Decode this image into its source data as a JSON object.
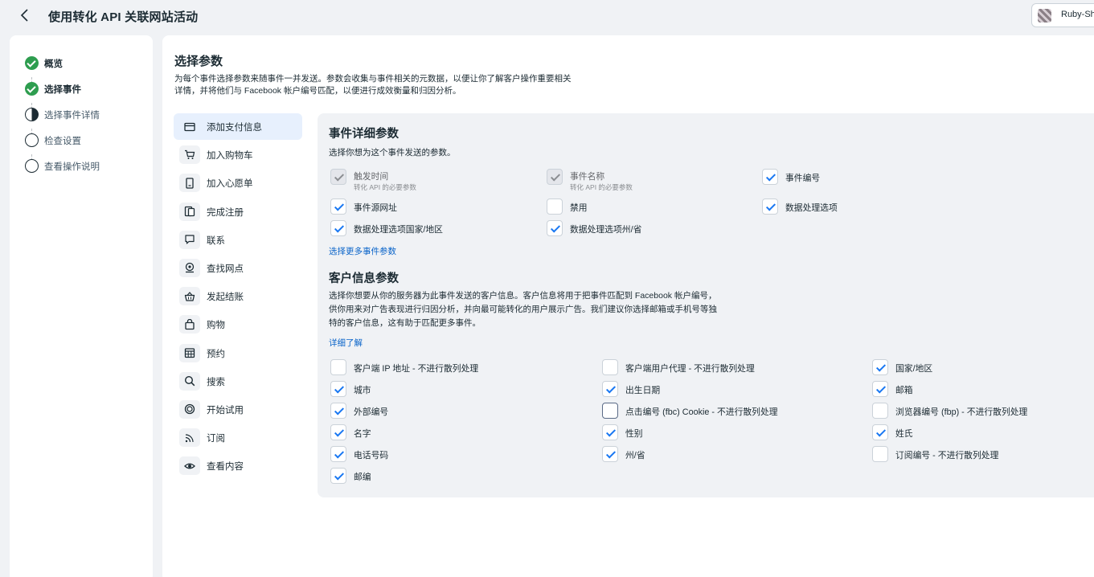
{
  "header": {
    "title": "使用转化 API 关联网站活动",
    "account_name": "Ruby-Sh"
  },
  "steps": [
    {
      "label": "概览",
      "state": "done"
    },
    {
      "label": "选择事件",
      "state": "done"
    },
    {
      "label": "选择事件详情",
      "state": "current"
    },
    {
      "label": "检查设置",
      "state": "todo"
    },
    {
      "label": "查看操作说明",
      "state": "todo"
    }
  ],
  "main": {
    "title": "选择参数",
    "description": "为每个事件选择参数来随事件一并发送。参数会收集与事件相关的元数据，以便让你了解客户操作重要相关详情，并将他们与 Facebook 帐户编号匹配，以便进行成效衡量和归因分析。"
  },
  "events": [
    {
      "label": "添加支付信息",
      "icon": "credit-card-icon",
      "glyph": "▭",
      "active": true
    },
    {
      "label": "加入购物车",
      "icon": "cart-icon",
      "glyph": "🛒"
    },
    {
      "label": "加入心愿单",
      "icon": "wishlist-icon",
      "glyph": "▯"
    },
    {
      "label": "完成注册",
      "icon": "registration-icon",
      "glyph": "❐"
    },
    {
      "label": "联系",
      "icon": "chat-bubble-icon",
      "glyph": "▢"
    },
    {
      "label": "查找网点",
      "icon": "location-pin-icon",
      "glyph": "⚲"
    },
    {
      "label": "发起结账",
      "icon": "basket-icon",
      "glyph": "⊟"
    },
    {
      "label": "购物",
      "icon": "shopping-bag-icon",
      "glyph": "⊞"
    },
    {
      "label": "预约",
      "icon": "calendar-icon",
      "glyph": "▦"
    },
    {
      "label": "搜索",
      "icon": "search-icon",
      "glyph": "⌕"
    },
    {
      "label": "开始试用",
      "icon": "trial-icon",
      "glyph": "◎"
    },
    {
      "label": "订阅",
      "icon": "rss-icon",
      "glyph": "≋"
    },
    {
      "label": "查看内容",
      "icon": "eye-icon",
      "glyph": "◉"
    }
  ],
  "event_params": {
    "title": "事件详细参数",
    "subtitle": "选择你想为这个事件发送的参数。",
    "items": [
      {
        "label": "触发时间",
        "sub": "转化 API 的必要参数",
        "checked": true,
        "disabled": true
      },
      {
        "label": "事件名称",
        "sub": "转化 API 的必要参数",
        "checked": true,
        "disabled": true
      },
      {
        "label": "事件编号",
        "checked": true
      },
      {
        "label": "事件源网址",
        "checked": true
      },
      {
        "label": "禁用",
        "checked": false
      },
      {
        "label": "数据处理选项",
        "checked": true
      },
      {
        "label": "数据处理选项国家/地区",
        "checked": true
      },
      {
        "label": "数据处理选项州/省",
        "checked": true
      }
    ],
    "more_link": "选择更多事件参数"
  },
  "customer_params": {
    "title": "客户信息参数",
    "description": "选择你想要从你的服务器为此事件发送的客户信息。客户信息将用于把事件匹配到 Facebook 帐户编号，供你用来对广告表现进行归因分析，并向最可能转化的用户展示广告。我们建议你选择邮箱或手机号等独特的客户信息，这有助于匹配更多事件。",
    "learn_more": "详细了解",
    "items": [
      {
        "label": "客户端 IP 地址 - 不进行散列处理",
        "checked": false
      },
      {
        "label": "客户端用户代理 - 不进行散列处理",
        "checked": false
      },
      {
        "label": "国家/地区",
        "checked": true
      },
      {
        "label": "城市",
        "checked": true
      },
      {
        "label": "出生日期",
        "checked": true
      },
      {
        "label": "邮箱",
        "checked": true
      },
      {
        "label": "外部编号",
        "checked": true
      },
      {
        "label": "点击编号 (fbc) Cookie - 不进行散列处理",
        "checked": false,
        "focused": true
      },
      {
        "label": "浏览器编号 (fbp) - 不进行散列处理",
        "checked": false
      },
      {
        "label": "名字",
        "checked": true
      },
      {
        "label": "性别",
        "checked": true
      },
      {
        "label": "姓氏",
        "checked": true
      },
      {
        "label": "电话号码",
        "checked": true
      },
      {
        "label": "州/省",
        "checked": true
      },
      {
        "label": "订阅编号 - 不进行散列处理",
        "checked": false
      },
      {
        "label": "邮编",
        "checked": true
      }
    ]
  },
  "colors": {
    "accent": "#1877f2",
    "success": "#2e9d4f",
    "link": "#0a64c9",
    "active_item_bg": "#e7f0fd",
    "page_bg": "#f0f2f5"
  }
}
